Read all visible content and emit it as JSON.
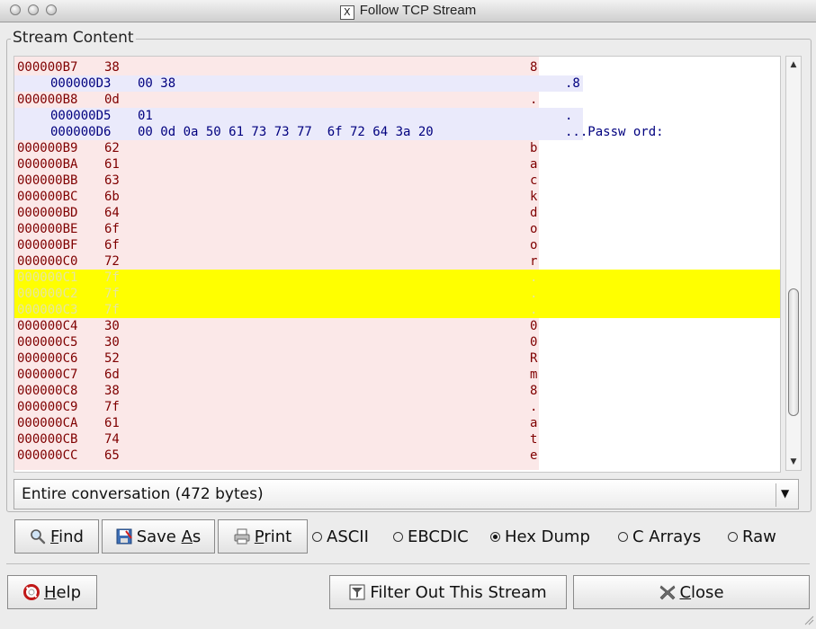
{
  "window": {
    "title": "Follow TCP Stream"
  },
  "group": {
    "title": "Stream Content"
  },
  "stream_lines": [
    {
      "side": "client",
      "offset": "000000B7",
      "hex": "38",
      "ascii": "8",
      "hl": false
    },
    {
      "side": "server",
      "offset": "000000D3",
      "hex": "00 38",
      "ascii": ".8",
      "hl": false
    },
    {
      "side": "client",
      "offset": "000000B8",
      "hex": "0d",
      "ascii": ".",
      "hl": false
    },
    {
      "side": "server",
      "offset": "000000D5",
      "hex": "01",
      "ascii": ".",
      "hl": false
    },
    {
      "side": "server",
      "offset": "000000D6",
      "hex": "00 0d 0a 50 61 73 73 77  6f 72 64 3a 20",
      "ascii": "...Passw ord:",
      "hl": false
    },
    {
      "side": "client",
      "offset": "000000B9",
      "hex": "62",
      "ascii": "b",
      "hl": false
    },
    {
      "side": "client",
      "offset": "000000BA",
      "hex": "61",
      "ascii": "a",
      "hl": false
    },
    {
      "side": "client",
      "offset": "000000BB",
      "hex": "63",
      "ascii": "c",
      "hl": false
    },
    {
      "side": "client",
      "offset": "000000BC",
      "hex": "6b",
      "ascii": "k",
      "hl": false
    },
    {
      "side": "client",
      "offset": "000000BD",
      "hex": "64",
      "ascii": "d",
      "hl": false
    },
    {
      "side": "client",
      "offset": "000000BE",
      "hex": "6f",
      "ascii": "o",
      "hl": false
    },
    {
      "side": "client",
      "offset": "000000BF",
      "hex": "6f",
      "ascii": "o",
      "hl": false
    },
    {
      "side": "client",
      "offset": "000000C0",
      "hex": "72",
      "ascii": "r",
      "hl": false
    },
    {
      "side": "client",
      "offset": "000000C1",
      "hex": "7f",
      "ascii": ".",
      "hl": true
    },
    {
      "side": "client",
      "offset": "000000C2",
      "hex": "7f",
      "ascii": ".",
      "hl": true
    },
    {
      "side": "client",
      "offset": "000000C3",
      "hex": "7f",
      "ascii": ".",
      "hl": true
    },
    {
      "side": "client",
      "offset": "000000C4",
      "hex": "30",
      "ascii": "0",
      "hl": false
    },
    {
      "side": "client",
      "offset": "000000C5",
      "hex": "30",
      "ascii": "0",
      "hl": false
    },
    {
      "side": "client",
      "offset": "000000C6",
      "hex": "52",
      "ascii": "R",
      "hl": false
    },
    {
      "side": "client",
      "offset": "000000C7",
      "hex": "6d",
      "ascii": "m",
      "hl": false
    },
    {
      "side": "client",
      "offset": "000000C8",
      "hex": "38",
      "ascii": "8",
      "hl": false
    },
    {
      "side": "client",
      "offset": "000000C9",
      "hex": "7f",
      "ascii": ".",
      "hl": false
    },
    {
      "side": "client",
      "offset": "000000CA",
      "hex": "61",
      "ascii": "a",
      "hl": false
    },
    {
      "side": "client",
      "offset": "000000CB",
      "hex": "74",
      "ascii": "t",
      "hl": false
    },
    {
      "side": "client",
      "offset": "000000CC",
      "hex": "65",
      "ascii": "e",
      "hl": false
    }
  ],
  "colors": {
    "client_text": "#7f0000",
    "client_bg": "#fbe8e8",
    "server_text": "#00007f",
    "server_bg": "#eaeafb",
    "highlight": "#ffff00"
  },
  "conversation_select": {
    "value": "Entire conversation (472 bytes)"
  },
  "toolbar": {
    "find": {
      "pre": "",
      "key": "F",
      "post": "ind",
      "icon": "magnifier-icon"
    },
    "save_as": {
      "pre": "Save ",
      "key": "A",
      "post": "s",
      "icon": "floppy-disk-icon"
    },
    "print": {
      "pre": "",
      "key": "P",
      "post": "rint",
      "icon": "printer-icon"
    }
  },
  "format_options": [
    {
      "label": "ASCII",
      "selected": false
    },
    {
      "label": "EBCDIC",
      "selected": false
    },
    {
      "label": "Hex Dump",
      "selected": true
    },
    {
      "label": "C Arrays",
      "selected": false
    },
    {
      "label": "Raw",
      "selected": false
    }
  ],
  "bottom": {
    "help": {
      "pre": "",
      "key": "H",
      "post": "elp",
      "icon": "lifebuoy-icon"
    },
    "filter": {
      "label": "Filter Out This Stream",
      "icon": "filter-icon"
    },
    "close": {
      "pre": "",
      "key": "C",
      "post": "lose",
      "icon": "close-x-icon"
    }
  }
}
